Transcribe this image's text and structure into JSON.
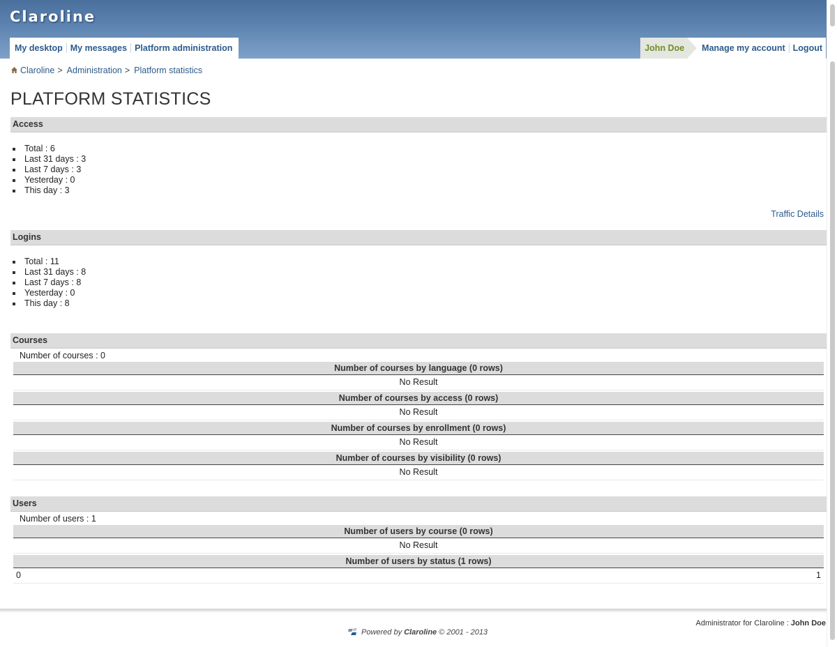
{
  "header": {
    "site_title": "Claroline",
    "nav_left": [
      "My desktop",
      "My messages",
      "Platform administration"
    ],
    "user_name": "John Doe",
    "nav_right": [
      "Manage my account",
      "Logout"
    ]
  },
  "breadcrumb": {
    "items": [
      "Claroline",
      "Administration",
      "Platform statistics"
    ],
    "separator": ">"
  },
  "page_title": "PLATFORM STATISTICS",
  "access": {
    "heading": "Access",
    "items": [
      "Total : 6",
      "Last 31 days : 3",
      "Last 7 days : 3",
      "Yesterday : 0",
      "This day : 3"
    ],
    "link": "Traffic Details"
  },
  "logins": {
    "heading": "Logins",
    "items": [
      "Total : 11",
      "Last 31 days : 8",
      "Last 7 days : 8",
      "Yesterday : 0",
      "This day : 8"
    ]
  },
  "courses": {
    "heading": "Courses",
    "count_line": "Number of courses : 0",
    "tables": [
      {
        "title": "Number of courses by language (0 rows)",
        "row": "No Result"
      },
      {
        "title": "Number of courses by access (0 rows)",
        "row": "No Result"
      },
      {
        "title": "Number of courses by enrollment (0 rows)",
        "row": "No Result"
      },
      {
        "title": "Number of courses by visibility (0 rows)",
        "row": "No Result"
      }
    ]
  },
  "users": {
    "heading": "Users",
    "count_line": "Number of users : 1",
    "tables": [
      {
        "title": "Number of users by course (0 rows)",
        "row": "No Result"
      },
      {
        "title": "Number of users by status (1 rows)",
        "row_left": "0",
        "row_right": "1"
      }
    ]
  },
  "footer": {
    "admin_prefix": "Administrator for Claroline :",
    "admin_name": "John Doe",
    "powered_prefix": "Powered by",
    "powered_name": "Claroline",
    "powered_suffix": "© 2001 - 2013"
  },
  "colors": {
    "banner": "#5d84b1",
    "link": "#2d5b8a",
    "user_tab_text": "#6e8f26",
    "section_head_bg": "#dcdcdc"
  }
}
